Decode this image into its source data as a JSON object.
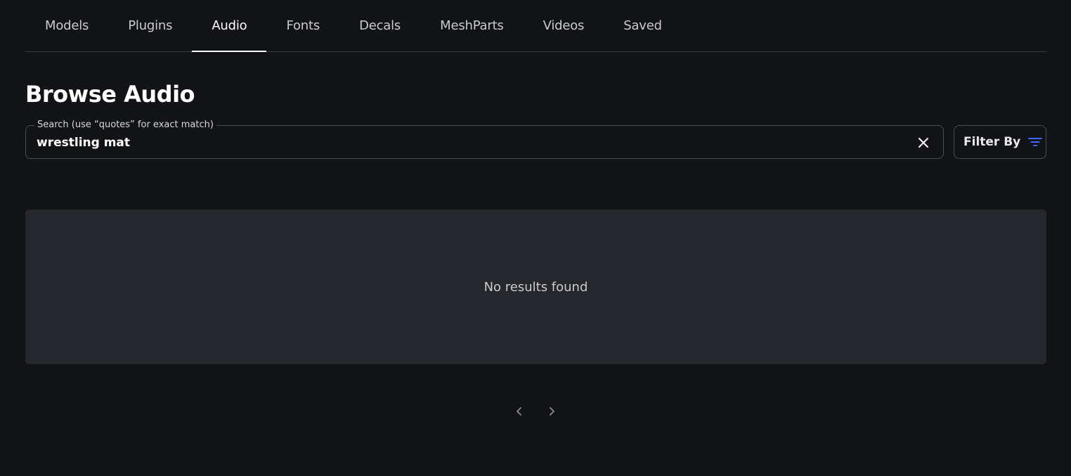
{
  "tabs": [
    {
      "label": "Models",
      "active": false
    },
    {
      "label": "Plugins",
      "active": false
    },
    {
      "label": "Audio",
      "active": true
    },
    {
      "label": "Fonts",
      "active": false
    },
    {
      "label": "Decals",
      "active": false
    },
    {
      "label": "MeshParts",
      "active": false
    },
    {
      "label": "Videos",
      "active": false
    },
    {
      "label": "Saved",
      "active": false
    }
  ],
  "page": {
    "title": "Browse Audio"
  },
  "search": {
    "label": "Search (use “quotes” for exact match)",
    "value": "wrestling mat",
    "clear_icon": "close-icon"
  },
  "filter": {
    "label": "Filter By",
    "icon": "filter-icon",
    "icon_color": "#3d6bff"
  },
  "results": {
    "empty_message": "No results found"
  },
  "pagination": {
    "prev_icon": "chevron-left-icon",
    "next_icon": "chevron-right-icon"
  },
  "colors": {
    "background": "#121317",
    "panel": "#26272c",
    "accent": "#3d6bff"
  }
}
